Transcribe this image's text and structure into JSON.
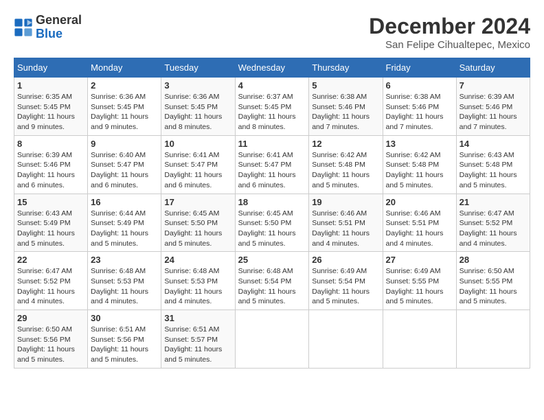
{
  "header": {
    "logo": {
      "general": "General",
      "blue": "Blue"
    },
    "title": "December 2024",
    "location": "San Felipe Cihualtepec, Mexico"
  },
  "weekdays": [
    "Sunday",
    "Monday",
    "Tuesday",
    "Wednesday",
    "Thursday",
    "Friday",
    "Saturday"
  ],
  "weeks": [
    [
      {
        "day": 1,
        "sunrise": "6:35 AM",
        "sunset": "5:45 PM",
        "daylight": "11 hours and 9 minutes."
      },
      {
        "day": 2,
        "sunrise": "6:36 AM",
        "sunset": "5:45 PM",
        "daylight": "11 hours and 9 minutes."
      },
      {
        "day": 3,
        "sunrise": "6:36 AM",
        "sunset": "5:45 PM",
        "daylight": "11 hours and 8 minutes."
      },
      {
        "day": 4,
        "sunrise": "6:37 AM",
        "sunset": "5:45 PM",
        "daylight": "11 hours and 8 minutes."
      },
      {
        "day": 5,
        "sunrise": "6:38 AM",
        "sunset": "5:46 PM",
        "daylight": "11 hours and 7 minutes."
      },
      {
        "day": 6,
        "sunrise": "6:38 AM",
        "sunset": "5:46 PM",
        "daylight": "11 hours and 7 minutes."
      },
      {
        "day": 7,
        "sunrise": "6:39 AM",
        "sunset": "5:46 PM",
        "daylight": "11 hours and 7 minutes."
      }
    ],
    [
      {
        "day": 8,
        "sunrise": "6:39 AM",
        "sunset": "5:46 PM",
        "daylight": "11 hours and 6 minutes."
      },
      {
        "day": 9,
        "sunrise": "6:40 AM",
        "sunset": "5:47 PM",
        "daylight": "11 hours and 6 minutes."
      },
      {
        "day": 10,
        "sunrise": "6:41 AM",
        "sunset": "5:47 PM",
        "daylight": "11 hours and 6 minutes."
      },
      {
        "day": 11,
        "sunrise": "6:41 AM",
        "sunset": "5:47 PM",
        "daylight": "11 hours and 6 minutes."
      },
      {
        "day": 12,
        "sunrise": "6:42 AM",
        "sunset": "5:48 PM",
        "daylight": "11 hours and 5 minutes."
      },
      {
        "day": 13,
        "sunrise": "6:42 AM",
        "sunset": "5:48 PM",
        "daylight": "11 hours and 5 minutes."
      },
      {
        "day": 14,
        "sunrise": "6:43 AM",
        "sunset": "5:48 PM",
        "daylight": "11 hours and 5 minutes."
      }
    ],
    [
      {
        "day": 15,
        "sunrise": "6:43 AM",
        "sunset": "5:49 PM",
        "daylight": "11 hours and 5 minutes."
      },
      {
        "day": 16,
        "sunrise": "6:44 AM",
        "sunset": "5:49 PM",
        "daylight": "11 hours and 5 minutes."
      },
      {
        "day": 17,
        "sunrise": "6:45 AM",
        "sunset": "5:50 PM",
        "daylight": "11 hours and 5 minutes."
      },
      {
        "day": 18,
        "sunrise": "6:45 AM",
        "sunset": "5:50 PM",
        "daylight": "11 hours and 5 minutes."
      },
      {
        "day": 19,
        "sunrise": "6:46 AM",
        "sunset": "5:51 PM",
        "daylight": "11 hours and 4 minutes."
      },
      {
        "day": 20,
        "sunrise": "6:46 AM",
        "sunset": "5:51 PM",
        "daylight": "11 hours and 4 minutes."
      },
      {
        "day": 21,
        "sunrise": "6:47 AM",
        "sunset": "5:52 PM",
        "daylight": "11 hours and 4 minutes."
      }
    ],
    [
      {
        "day": 22,
        "sunrise": "6:47 AM",
        "sunset": "5:52 PM",
        "daylight": "11 hours and 4 minutes."
      },
      {
        "day": 23,
        "sunrise": "6:48 AM",
        "sunset": "5:53 PM",
        "daylight": "11 hours and 4 minutes."
      },
      {
        "day": 24,
        "sunrise": "6:48 AM",
        "sunset": "5:53 PM",
        "daylight": "11 hours and 4 minutes."
      },
      {
        "day": 25,
        "sunrise": "6:48 AM",
        "sunset": "5:54 PM",
        "daylight": "11 hours and 5 minutes."
      },
      {
        "day": 26,
        "sunrise": "6:49 AM",
        "sunset": "5:54 PM",
        "daylight": "11 hours and 5 minutes."
      },
      {
        "day": 27,
        "sunrise": "6:49 AM",
        "sunset": "5:55 PM",
        "daylight": "11 hours and 5 minutes."
      },
      {
        "day": 28,
        "sunrise": "6:50 AM",
        "sunset": "5:55 PM",
        "daylight": "11 hours and 5 minutes."
      }
    ],
    [
      {
        "day": 29,
        "sunrise": "6:50 AM",
        "sunset": "5:56 PM",
        "daylight": "11 hours and 5 minutes."
      },
      {
        "day": 30,
        "sunrise": "6:51 AM",
        "sunset": "5:56 PM",
        "daylight": "11 hours and 5 minutes."
      },
      {
        "day": 31,
        "sunrise": "6:51 AM",
        "sunset": "5:57 PM",
        "daylight": "11 hours and 5 minutes."
      },
      null,
      null,
      null,
      null
    ]
  ],
  "labels": {
    "sunrise": "Sunrise:",
    "sunset": "Sunset:",
    "daylight": "Daylight:"
  }
}
